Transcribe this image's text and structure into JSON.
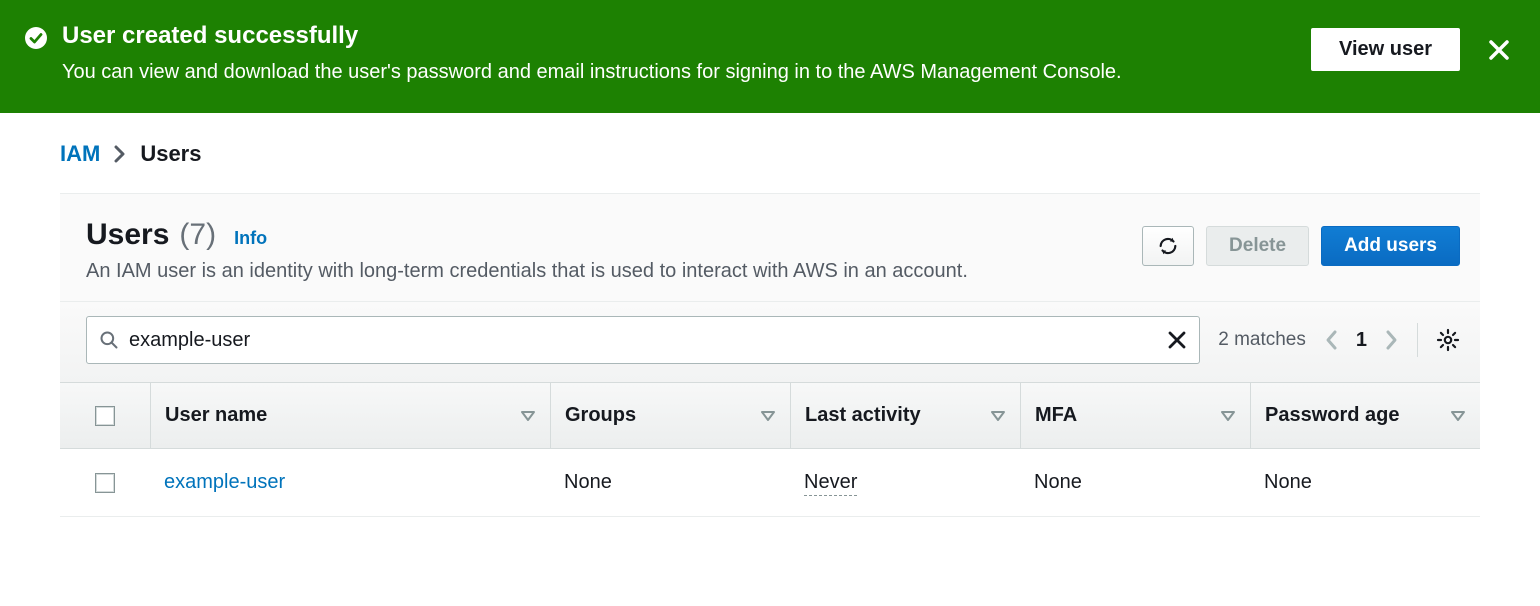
{
  "banner": {
    "title": "User created successfully",
    "description": "You can view and download the user's password and email instructions for signing in to the AWS Management Console.",
    "view_user_label": "View user"
  },
  "breadcrumb": {
    "root": "IAM",
    "current": "Users"
  },
  "header": {
    "title": "Users",
    "count": "(7)",
    "info_label": "Info",
    "description": "An IAM user is an identity with long-term credentials that is used to interact with AWS in an account.",
    "delete_label": "Delete",
    "add_users_label": "Add users"
  },
  "filter": {
    "search_value": "example-user",
    "matches_text": "2 matches",
    "page_number": "1"
  },
  "columns": {
    "user_name": "User name",
    "groups": "Groups",
    "last_activity": "Last activity",
    "mfa": "MFA",
    "password_age": "Password age"
  },
  "rows": [
    {
      "user_name": "example-user",
      "groups": "None",
      "last_activity": "Never",
      "mfa": "None",
      "password_age": "None"
    }
  ]
}
